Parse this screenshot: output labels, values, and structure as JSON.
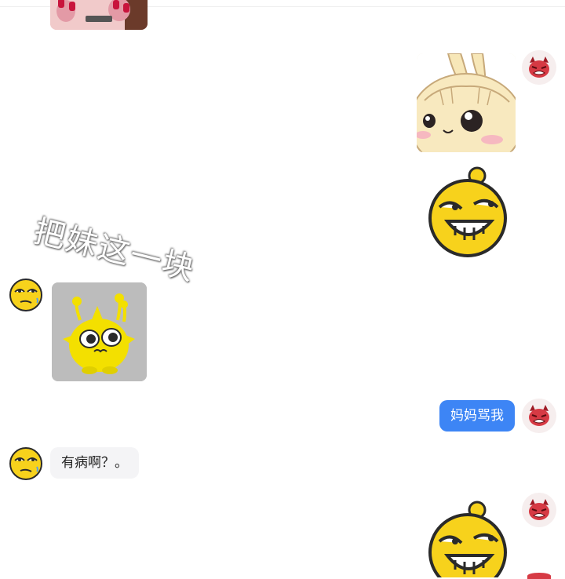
{
  "overlay": {
    "watermark_text": "把妹这一块"
  },
  "messages": [
    {
      "side": "left",
      "kind": "image",
      "content": "photo-nails-thumbnail"
    },
    {
      "side": "right",
      "kind": "sticker",
      "content": "bunny-face-sticker"
    },
    {
      "side": "right",
      "kind": "sticker",
      "content": "grinning-emoji-sticker"
    },
    {
      "side": "left",
      "kind": "sticker",
      "content": "yellow-creature-sticker"
    },
    {
      "side": "right",
      "kind": "text",
      "text": "妈妈骂我"
    },
    {
      "side": "left",
      "kind": "text",
      "text": "有病啊？。"
    },
    {
      "side": "right",
      "kind": "sticker",
      "content": "grinning-emoji-sticker"
    }
  ],
  "avatars": {
    "me": "red-devil-face-icon",
    "contact": "squinting-emoji-face-icon"
  },
  "colors": {
    "my_bubble": "#3d85f5",
    "their_bubble": "#f4f4f6",
    "background": "#ffffff"
  }
}
